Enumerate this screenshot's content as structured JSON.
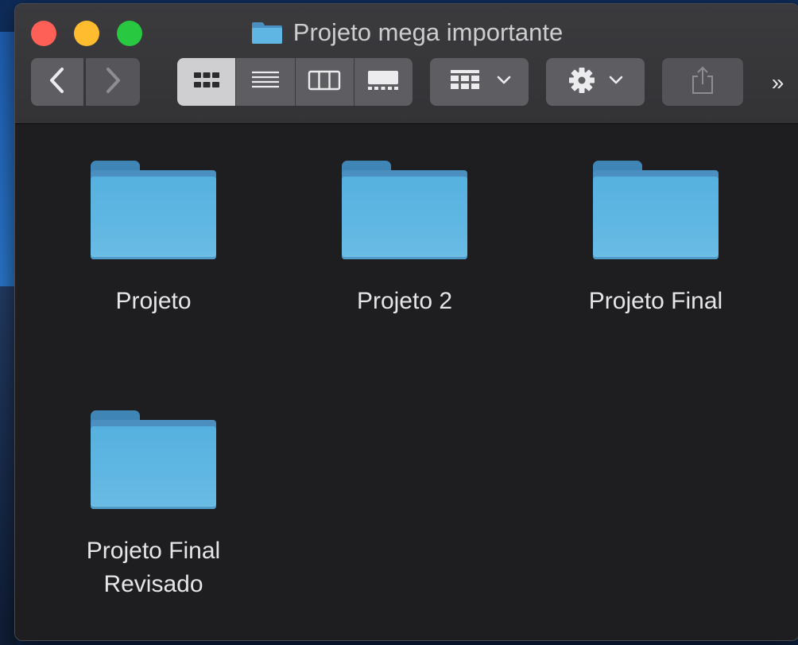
{
  "window": {
    "title": "Projeto mega importante"
  },
  "toolbar": {
    "back_icon": "chevron-left-icon",
    "forward_icon": "chevron-right-icon",
    "view_modes": [
      "icon-view",
      "list-view",
      "column-view",
      "gallery-view"
    ],
    "selected_view": "icon-view",
    "group_icon": "group-by-icon",
    "action_icon": "gear-icon",
    "share_icon": "share-icon",
    "more_label": "»"
  },
  "items": [
    {
      "label": "Projeto",
      "icon": "folder-icon"
    },
    {
      "label": "Projeto 2",
      "icon": "folder-icon"
    },
    {
      "label": "Projeto Final",
      "icon": "folder-icon"
    },
    {
      "label": "Projeto Final Revisado",
      "icon": "folder-icon"
    }
  ],
  "colors": {
    "folder": "#5fb6e2",
    "close": "#fe5f57",
    "minimize": "#febc2e",
    "zoom": "#28c840",
    "window_bg": "#1e1e21"
  }
}
